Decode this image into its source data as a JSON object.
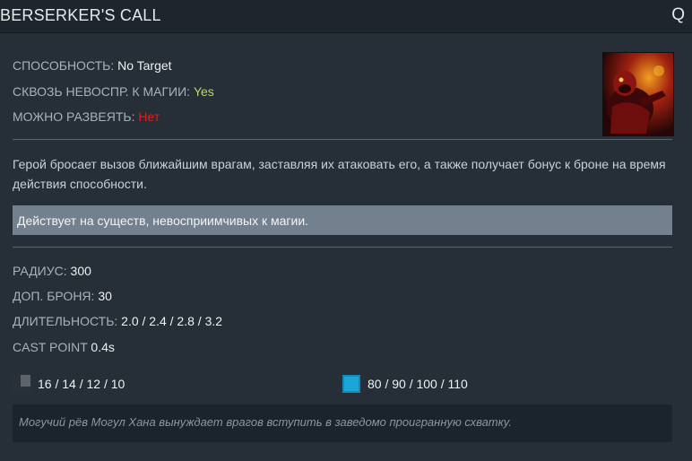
{
  "ability": {
    "name": "BERSERKER'S CALL",
    "hotkey": "Q"
  },
  "properties": [
    {
      "label": "СПОСОБНОСТЬ:",
      "value": "No Target",
      "kind": "normal"
    },
    {
      "label": "СКВОЗЬ НЕВОСПР. К МАГИИ:",
      "value": "Yes",
      "kind": "yes"
    },
    {
      "label": "МОЖНО РАЗВЕЯТЬ:",
      "value": "Нет",
      "kind": "no"
    }
  ],
  "description": "Герой бросает вызов ближайшим врагам, заставляя их атаковать его, а также получает бонус к броне на время действия способности.",
  "note": "Действует на существ, невосприимчивых к магии.",
  "stats": [
    {
      "label": "РАДИУС:",
      "value": "300"
    },
    {
      "label": "ДОП. БРОНЯ:",
      "value": "30"
    },
    {
      "label": "ДЛИТЕЛЬНОСТЬ:",
      "value": "2.0 / 2.4 / 2.8 / 3.2"
    },
    {
      "label": "CAST POINT",
      "value": "0.4s"
    }
  ],
  "cooldown": {
    "icon": "cooldown-icon",
    "value": "16 / 14 / 12 / 10"
  },
  "mana": {
    "icon": "mana-icon",
    "value": "80 / 90 / 100 / 110"
  },
  "lore": "Могучий рёв Могул Хана вынуждает врагов вступить в заведомо проигранную схватку.",
  "portrait": {
    "icon": "berserkers-call-portrait-icon"
  },
  "colors": {
    "background": "#262e37",
    "header": "#1e252d",
    "yes": "#b8d86a",
    "no": "#e0201c",
    "note_bg": "#73818f",
    "lore_bg": "#1b232c",
    "mana": "#1aa7d8",
    "cooldown": "#5c636b"
  }
}
